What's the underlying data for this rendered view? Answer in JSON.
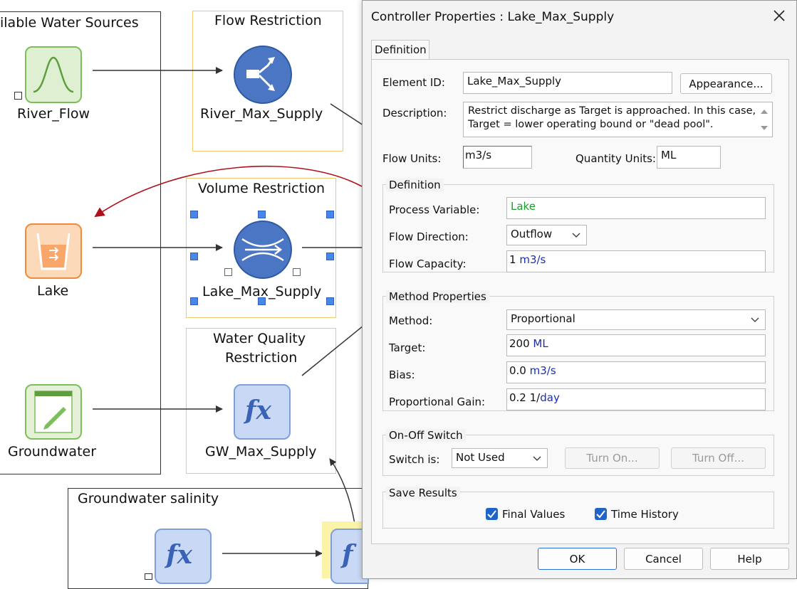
{
  "diagram": {
    "sources_box": {
      "title": "ilable Water Sources"
    },
    "flow_restriction": {
      "title": "Flow Restriction",
      "element": "River_Max_Supply"
    },
    "volume_restriction": {
      "title": "Volume Restriction",
      "element": "Lake_Max_Supply"
    },
    "water_quality": {
      "title_line1": "Water Quality",
      "title_line2": "Restriction",
      "element": "GW_Max_Supply"
    },
    "sources": [
      {
        "label": "River_Flow"
      },
      {
        "label": "Lake"
      },
      {
        "label": "Groundwater"
      }
    ],
    "salinity_box": {
      "title": "Groundwater salinity"
    },
    "colors": {
      "arrow": "#333333",
      "feedback_arrow": "#b0101c",
      "group_border": "#f0c870",
      "selection_handle": "#4a86e8"
    }
  },
  "dialog": {
    "title": "Controller Properties : Lake_Max_Supply",
    "tab": "Definition",
    "element_id_label": "Element ID:",
    "element_id_value": "Lake_Max_Supply",
    "appearance_button": "Appearance...",
    "description_label": "Description:",
    "description_line1": "Restrict discharge as Target is approached. In this case,",
    "description_line2": "Target = lower operating bound or \"dead pool\".",
    "flow_units_label": "Flow Units:",
    "flow_units_value": "m3/s",
    "quantity_units_label": "Quantity Units:",
    "quantity_units_value": "ML",
    "definition_group": {
      "title": "Definition",
      "process_variable_label": "Process Variable:",
      "process_variable_value": "Lake",
      "flow_direction_label": "Flow Direction:",
      "flow_direction_value": "Outflow",
      "flow_capacity_label": "Flow Capacity:",
      "flow_capacity_number": "1",
      "flow_capacity_unit": "m3/s"
    },
    "method_group": {
      "title": "Method Properties",
      "method_label": "Method:",
      "method_value": "Proportional",
      "target_label": "Target:",
      "target_number": "200",
      "target_unit": "ML",
      "bias_label": "Bias:",
      "bias_number": "0.0",
      "bias_unit": "m3/s",
      "gain_label": "Proportional Gain:",
      "gain_number": "0.2",
      "gain_unit_prefix": "1/",
      "gain_unit": "day"
    },
    "onoff_group": {
      "title": "On-Off Switch",
      "switch_label": "Switch is:",
      "switch_value": "Not Used",
      "turn_on": "Turn On...",
      "turn_off": "Turn Off..."
    },
    "save_group": {
      "title": "Save Results",
      "final_values": "Final Values",
      "time_history": "Time History"
    },
    "ok": "OK",
    "cancel": "Cancel",
    "help": "Help"
  }
}
